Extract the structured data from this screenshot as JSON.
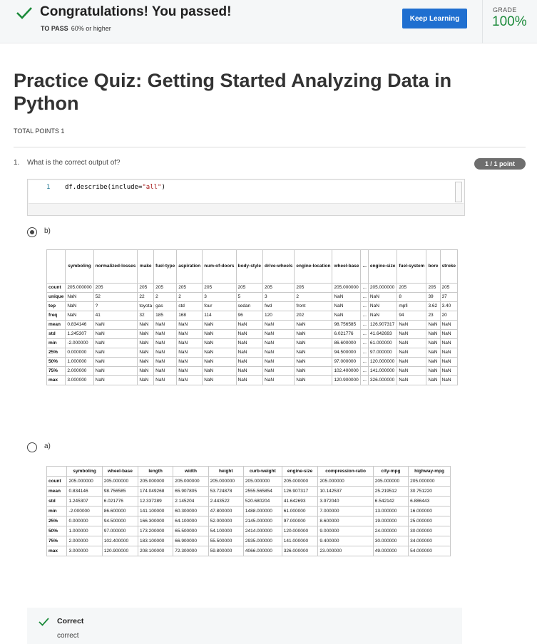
{
  "banner": {
    "title": "Congratulations! You passed!",
    "to_pass_label": "TO PASS",
    "to_pass_value": "60% or higher",
    "keep_learning": "Keep Learning",
    "grade_label": "GRADE",
    "grade_value": "100%",
    "accent_color": "#1b8a3a",
    "button_color": "#1f6fd0"
  },
  "quiz": {
    "title": "Practice Quiz: Getting Started Analyzing Data in Python",
    "total_points": "TOTAL POINTS 1"
  },
  "question": {
    "number": "1.",
    "text": "What is the correct output of?",
    "points_badge": "1 / 1 point",
    "code": {
      "line_number": "1",
      "text_before": "df.describe(include=",
      "string": "\"all\"",
      "text_after": ")"
    },
    "options": [
      {
        "label": "b)",
        "selected": true
      },
      {
        "label": "a)",
        "selected": false
      }
    ]
  },
  "table_b": {
    "columns": [
      "",
      "symboling",
      "normalized-losses",
      "make",
      "fuel-type",
      "aspiration",
      "num-of-doors",
      "body-style",
      "drive-wheels",
      "engine-location",
      "wheel-base",
      "...",
      "engine-size",
      "fuel-system",
      "bore",
      "stroke"
    ],
    "rows": [
      [
        "count",
        "205.000000",
        "205",
        "205",
        "205",
        "205",
        "205",
        "205",
        "205",
        "205",
        "205.000000",
        "...",
        "205.000000",
        "205",
        "205",
        "205"
      ],
      [
        "unique",
        "NaN",
        "52",
        "22",
        "2",
        "2",
        "3",
        "5",
        "3",
        "2",
        "NaN",
        "...",
        "NaN",
        "8",
        "39",
        "37"
      ],
      [
        "top",
        "NaN",
        "?",
        "toyota",
        "gas",
        "std",
        "four",
        "sedan",
        "fwd",
        "front",
        "NaN",
        "...",
        "NaN",
        "mpfi",
        "3.62",
        "3.40"
      ],
      [
        "freq",
        "NaN",
        "41",
        "32",
        "185",
        "168",
        "114",
        "96",
        "120",
        "202",
        "NaN",
        "...",
        "NaN",
        "94",
        "23",
        "20"
      ],
      [
        "mean",
        "0.834146",
        "NaN",
        "NaN",
        "NaN",
        "NaN",
        "NaN",
        "NaN",
        "NaN",
        "NaN",
        "98.756585",
        "...",
        "126.907317",
        "NaN",
        "NaN",
        "NaN"
      ],
      [
        "std",
        "1.245307",
        "NaN",
        "NaN",
        "NaN",
        "NaN",
        "NaN",
        "NaN",
        "NaN",
        "NaN",
        "6.021776",
        "...",
        "41.642693",
        "NaN",
        "NaN",
        "NaN"
      ],
      [
        "min",
        "-2.000000",
        "NaN",
        "NaN",
        "NaN",
        "NaN",
        "NaN",
        "NaN",
        "NaN",
        "NaN",
        "86.600000",
        "...",
        "61.000000",
        "NaN",
        "NaN",
        "NaN"
      ],
      [
        "25%",
        "0.000000",
        "NaN",
        "NaN",
        "NaN",
        "NaN",
        "NaN",
        "NaN",
        "NaN",
        "NaN",
        "94.500000",
        "...",
        "97.000000",
        "NaN",
        "NaN",
        "NaN"
      ],
      [
        "50%",
        "1.000000",
        "NaN",
        "NaN",
        "NaN",
        "NaN",
        "NaN",
        "NaN",
        "NaN",
        "NaN",
        "97.000000",
        "...",
        "120.000000",
        "NaN",
        "NaN",
        "NaN"
      ],
      [
        "75%",
        "2.000000",
        "NaN",
        "NaN",
        "NaN",
        "NaN",
        "NaN",
        "NaN",
        "NaN",
        "NaN",
        "102.400000",
        "...",
        "141.000000",
        "NaN",
        "NaN",
        "NaN"
      ],
      [
        "max",
        "3.000000",
        "NaN",
        "NaN",
        "NaN",
        "NaN",
        "NaN",
        "NaN",
        "NaN",
        "NaN",
        "120.900000",
        "...",
        "326.000000",
        "NaN",
        "NaN",
        "NaN"
      ]
    ]
  },
  "table_a": {
    "columns": [
      "",
      "symboling",
      "wheel-base",
      "length",
      "width",
      "height",
      "curb-weight",
      "engine-size",
      "compression-ratio",
      "city-mpg",
      "highway-mpg"
    ],
    "rows": [
      [
        "count",
        "205.000000",
        "205.000000",
        "205.000000",
        "205.000000",
        "205.000000",
        "205.000000",
        "205.000000",
        "205.000000",
        "205.000000",
        "205.000000"
      ],
      [
        "mean",
        "0.834146",
        "98.756585",
        "174.049268",
        "65.907805",
        "53.724878",
        "2555.565854",
        "126.907317",
        "10.142537",
        "25.219512",
        "30.751220"
      ],
      [
        "std",
        "1.245307",
        "6.021776",
        "12.337289",
        "2.145204",
        "2.443522",
        "520.680204",
        "41.642693",
        "3.972040",
        "6.542142",
        "6.886443"
      ],
      [
        "min",
        "-2.000000",
        "86.600000",
        "141.100000",
        "60.300000",
        "47.800000",
        "1488.000000",
        "61.000000",
        "7.000000",
        "13.000000",
        "16.000000"
      ],
      [
        "25%",
        "0.000000",
        "94.500000",
        "166.300000",
        "64.100000",
        "52.000000",
        "2145.000000",
        "97.000000",
        "8.600000",
        "19.000000",
        "25.000000"
      ],
      [
        "50%",
        "1.000000",
        "97.000000",
        "173.200000",
        "65.500000",
        "54.100000",
        "2414.000000",
        "120.000000",
        "9.000000",
        "24.000000",
        "30.000000"
      ],
      [
        "75%",
        "2.000000",
        "102.400000",
        "183.100000",
        "66.900000",
        "55.500000",
        "2935.000000",
        "141.000000",
        "9.400000",
        "30.000000",
        "34.000000"
      ],
      [
        "max",
        "3.000000",
        "120.900000",
        "208.100000",
        "72.300000",
        "59.800000",
        "4066.000000",
        "326.000000",
        "23.000000",
        "49.000000",
        "54.000000"
      ]
    ]
  },
  "feedback": {
    "title": "Correct",
    "text": "correct"
  }
}
